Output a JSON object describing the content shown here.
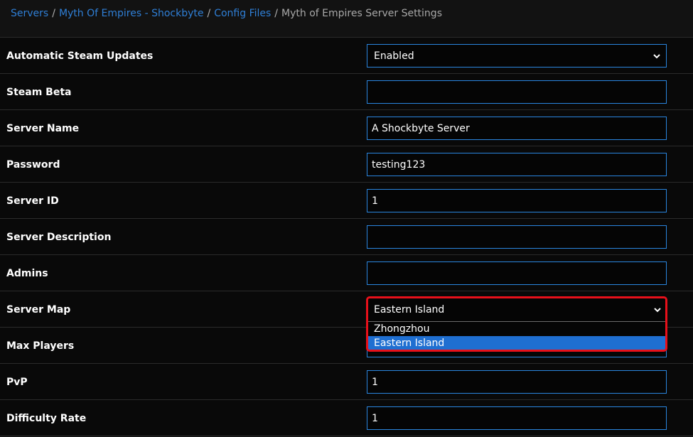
{
  "breadcrumb": {
    "items": [
      "Servers",
      "Myth Of Empires - Shockbyte",
      "Config Files"
    ],
    "current": "Myth of Empires Server Settings",
    "separator": "/"
  },
  "settings": [
    {
      "label": "Automatic Steam Updates",
      "type": "select",
      "value": "Enabled"
    },
    {
      "label": "Steam Beta",
      "type": "input",
      "value": ""
    },
    {
      "label": "Server Name",
      "type": "input",
      "value": "A Shockbyte Server"
    },
    {
      "label": "Password",
      "type": "input",
      "value": "testing123"
    },
    {
      "label": "Server ID",
      "type": "input",
      "value": "1"
    },
    {
      "label": "Server Description",
      "type": "input",
      "value": ""
    },
    {
      "label": "Admins",
      "type": "input",
      "value": ""
    },
    {
      "label": "Server Map",
      "type": "select",
      "value": "Eastern Island"
    },
    {
      "label": "Max Players",
      "type": "input",
      "value": ""
    },
    {
      "label": "PvP",
      "type": "input",
      "value": "1"
    },
    {
      "label": "Difficulty Rate",
      "type": "input",
      "value": "1"
    }
  ],
  "server_map_dropdown": {
    "selected": "Eastern Island",
    "options": [
      "Zhongzhou",
      "Eastern Island"
    ]
  },
  "colors": {
    "link": "#2f7fd6",
    "field_border": "#2a86e0",
    "highlight": "#e8101a",
    "option_selected": "#1f6fd1"
  }
}
